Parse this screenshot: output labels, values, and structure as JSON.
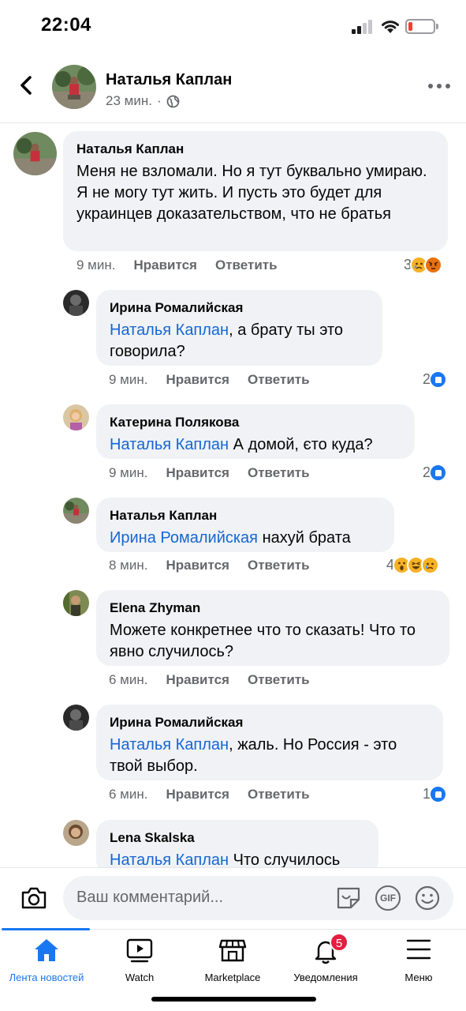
{
  "status_bar": {
    "time": "22:04"
  },
  "post_header": {
    "author": "Наталья Каплан",
    "time": "23 мин.",
    "separator": "·",
    "privacy_icon": "globe-icon"
  },
  "comments": [
    {
      "name": "Наталья Каплан",
      "mention": "",
      "text": "Меня не взломали. Но я тут буквально умираю. Я не могу тут жить. И пусть это будет для украинцев доказательством, что не братья",
      "time": "9 мин.",
      "like": "Нравится",
      "reply": "Ответить",
      "reaction_count": "3",
      "reactions": [
        "sad",
        "angry"
      ]
    },
    {
      "name": "Ирина Ромалийская",
      "mention": "Наталья Каплан",
      "text": ", а брату ты это говорила?",
      "time": "9 мин.",
      "like": "Нравится",
      "reply": "Ответить",
      "reaction_count": "2",
      "reactions": [
        "like"
      ]
    },
    {
      "name": "Катерина Полякова",
      "mention": "Наталья Каплан",
      "text": " А домой, єто куда?",
      "time": "9 мин.",
      "like": "Нравится",
      "reply": "Ответить",
      "reaction_count": "2",
      "reactions": [
        "like"
      ]
    },
    {
      "name": "Наталья Каплан",
      "mention": "Ирина Ромалийская",
      "text": " нахуй брата",
      "time": "8 мин.",
      "like": "Нравится",
      "reply": "Ответить",
      "reaction_count": "4",
      "reactions": [
        "wow",
        "haha",
        "sad"
      ]
    },
    {
      "name": "Elena Zhyman",
      "mention": "",
      "text": "Можете конкретнее что то сказать! Что то явно случилось?",
      "time": "6 мин.",
      "like": "Нравится",
      "reply": "Ответить",
      "reaction_count": "",
      "reactions": []
    },
    {
      "name": "Ирина Ромалийская",
      "mention": "Наталья Каплан",
      "text": ", жаль. Но Россия - это твой выбор.",
      "time": "6 мин.",
      "like": "Нравится",
      "reply": "Ответить",
      "reaction_count": "1",
      "reactions": [
        "like"
      ]
    },
    {
      "name": "Lena Skalska",
      "mention": "Наталья Каплан",
      "text": " Что случилось",
      "time": "",
      "like": "",
      "reply": "",
      "reaction_count": "",
      "reactions": []
    }
  ],
  "composer": {
    "placeholder": "Ваш комментарий..."
  },
  "tabs": [
    {
      "label": "Лента новостей",
      "icon": "home-icon",
      "active": true
    },
    {
      "label": "Watch",
      "icon": "watch-icon",
      "active": false
    },
    {
      "label": "Marketplace",
      "icon": "marketplace-icon",
      "active": false
    },
    {
      "label": "Уведомления",
      "icon": "bell-icon",
      "active": false,
      "badge": "5"
    },
    {
      "label": "Меню",
      "icon": "menu-icon",
      "active": false
    }
  ],
  "colors": {
    "link": "#1567d3",
    "brand": "#1877f2",
    "bubble": "#f0f2f5",
    "badge": "#e41e3f"
  }
}
